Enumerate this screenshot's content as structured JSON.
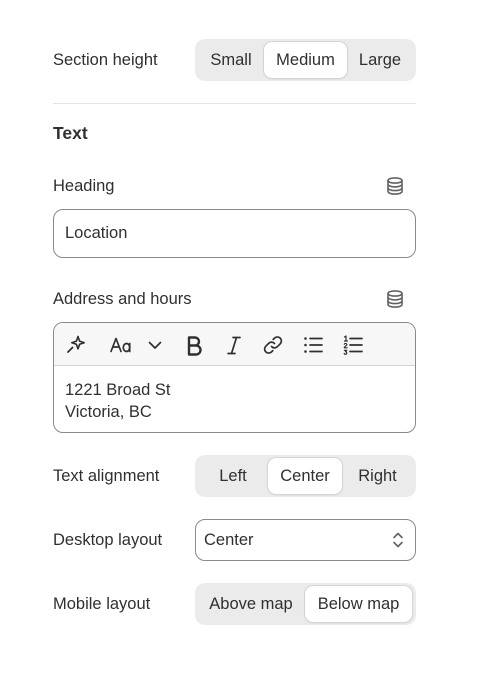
{
  "section_height": {
    "label": "Section height",
    "options": [
      "Small",
      "Medium",
      "Large"
    ],
    "selected": "Medium"
  },
  "text_section": {
    "title": "Text"
  },
  "heading": {
    "label": "Heading",
    "value": "Location",
    "icon": "database-icon"
  },
  "address": {
    "label": "Address and hours",
    "icon": "database-icon",
    "toolbar": [
      "magic-icon",
      "font-size-icon",
      "chevron-down-icon",
      "bold-icon",
      "italic-icon",
      "link-icon",
      "bullet-list-icon",
      "numbered-list-icon"
    ],
    "lines": [
      "1221 Broad St",
      "Victoria, BC"
    ]
  },
  "text_alignment": {
    "label": "Text alignment",
    "options": [
      "Left",
      "Center",
      "Right"
    ],
    "selected": "Center"
  },
  "desktop_layout": {
    "label": "Desktop layout",
    "value": "Center"
  },
  "mobile_layout": {
    "label": "Mobile layout",
    "options": [
      "Above map",
      "Below map"
    ],
    "selected": "Below map"
  }
}
